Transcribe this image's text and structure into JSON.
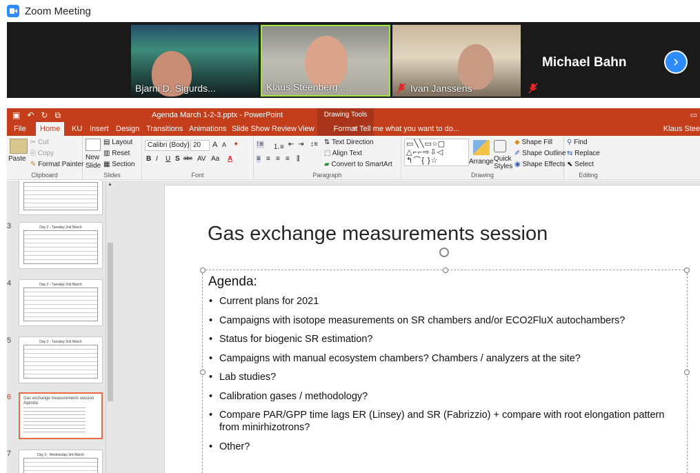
{
  "zoom": {
    "window_title": "Zoom Meeting",
    "participants": [
      {
        "name": "Bjarni D. Sigurds...",
        "muted": false,
        "active_speaker": false
      },
      {
        "name": "Klaus Steenberg ...",
        "muted": false,
        "active_speaker": true
      },
      {
        "name": "Ivan Janssens",
        "muted": true,
        "active_speaker": false
      },
      {
        "name": "Michael Bahn",
        "muted": true,
        "active_speaker": false,
        "video_off": true
      }
    ],
    "next_page_icon": "chevron-right-icon",
    "accent_color": "#2d8cff",
    "active_speaker_color": "#9ee53f"
  },
  "ppt": {
    "title": "Agenda March 1-2-3.pptx - PowerPoint",
    "contextual_group": "Drawing Tools",
    "accent_color": "#c43e1c",
    "tabs": [
      "File",
      "Home",
      "KU",
      "Insert",
      "Design",
      "Transitions",
      "Animations",
      "Slide Show",
      "Review",
      "View",
      "Format"
    ],
    "active_tab": "Home",
    "tell_me": "Tell me what you want to do...",
    "user_name": "Klaus Stee",
    "ribbon": {
      "clipboard": {
        "label": "Clipboard",
        "paste": "Paste",
        "cut": "Cut",
        "copy": "Copy",
        "format_painter": "Format Painter"
      },
      "slides": {
        "label": "Slides",
        "new_slide_1": "New",
        "new_slide_2": "Slide",
        "layout": "Layout",
        "reset": "Reset",
        "section": "Section"
      },
      "font": {
        "label": "Font",
        "font_name": "Calibri (Body)",
        "font_size": "20",
        "bold": "B",
        "italic": "I",
        "underline": "U",
        "shadow": "S",
        "strike": "abc",
        "spacing": "AV",
        "case": "Aa",
        "grow": "A",
        "shrink": "A",
        "color": "A"
      },
      "paragraph": {
        "label": "Paragraph",
        "text_direction": "Text Direction",
        "align_text": "Align Text",
        "convert_smartart": "Convert to SmartArt"
      },
      "drawing": {
        "label": "Drawing",
        "arrange": "Arrange",
        "quick_styles_1": "Quick",
        "quick_styles_2": "Styles",
        "shape_fill": "Shape Fill",
        "shape_outline": "Shape Outline",
        "shape_effects": "Shape Effects"
      },
      "editing": {
        "label": "Editing",
        "find": "Find",
        "replace": "Replace",
        "select": "Select"
      }
    },
    "thumbnails": [
      {
        "number": "",
        "title": ""
      },
      {
        "number": "3",
        "title": "Day 2 - Tuesday 2nd March"
      },
      {
        "number": "4",
        "title": "Day 2 - Tuesday 2nd March"
      },
      {
        "number": "5",
        "title": "Day 2 - Tuesday 2nd March"
      },
      {
        "number": "6",
        "title": "Gas exchange measurements session",
        "subtitle": "Agenda:",
        "selected": true
      },
      {
        "number": "7",
        "title": "Day 3 - Wednesday 3rd March"
      }
    ]
  },
  "slide": {
    "title": "Gas exchange measurements session",
    "heading": "Agenda:",
    "bullets": [
      "Current plans for 2021",
      "Campaigns with isotope measurements on SR chambers and/or ECO2FluX autochambers?",
      "Status for biogenic SR estimation?",
      "Campaigns with manual ecosystem chambers? Chambers / analyzers at the site?",
      "Lab studies?",
      "Calibration gases / methodology?",
      "Compare PAR/GPP time lags ER (Linsey) and SR (Fabrizzio) + compare with root elongation pattern from minirhizotrons?",
      "Other?"
    ]
  }
}
